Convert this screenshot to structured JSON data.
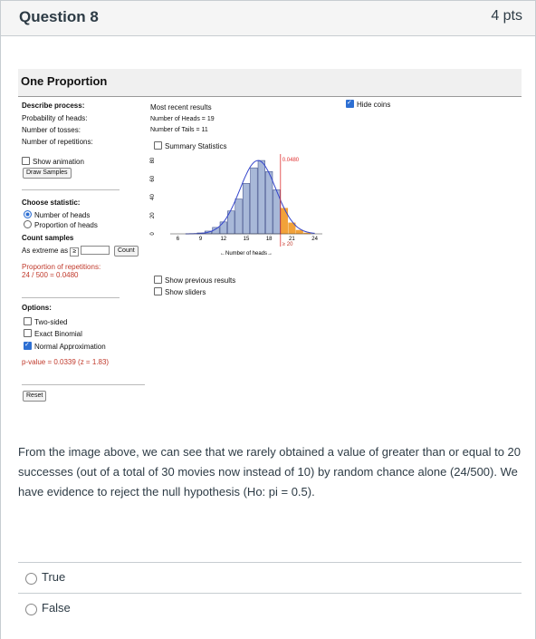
{
  "question": {
    "title": "Question 8",
    "points": "4 pts"
  },
  "applet": {
    "title": "One Proportion",
    "describe": {
      "heading": "Describe process:",
      "prob_label": "Probability of heads:",
      "tosses_label": "Number of tosses:",
      "reps_label": "Number of repetitions:",
      "show_animation": "Show animation",
      "draw_button": "Draw Samples"
    },
    "results": {
      "heading": "Most recent results",
      "heads": "Number of Heads = 19",
      "tails": "Number of Tails = 11",
      "summary": "Summary Statistics",
      "hide_coins": "Hide coins",
      "show_previous": "Show previous results",
      "show_sliders": "Show sliders"
    },
    "statistic": {
      "heading": "Choose statistic:",
      "opt1": "Number of heads",
      "opt2": "Proportion of heads"
    },
    "count": {
      "heading": "Count samples",
      "extreme_label": "As extreme as",
      "operator": "≥",
      "button": "Count",
      "result_label": "Proportion of repetitions:",
      "result_value": "24 / 500 = 0.0480"
    },
    "options": {
      "heading": "Options:",
      "two_sided": "Two-sided",
      "exact": "Exact Binomial",
      "normal": "Normal Approximation",
      "pvalue": "p-value = 0.0339 (z = 1.83)"
    },
    "reset": "Reset"
  },
  "chart_data": {
    "type": "bar",
    "xlabel": "←Number of heads→",
    "ylabel": "",
    "x_ticks": [
      "6",
      "9",
      "12",
      "15",
      "18",
      "21",
      "24"
    ],
    "y_ticks": [
      "0",
      "20",
      "40",
      "60",
      "80"
    ],
    "ylim": [
      0,
      85
    ],
    "xlim": [
      5,
      25
    ],
    "cutoff": 20,
    "cutoff_label": "≥ 20",
    "proportion_label": "0.0480",
    "heads": [
      9,
      10,
      11,
      12,
      13,
      14,
      15,
      16,
      17,
      18,
      19,
      20,
      21,
      22,
      23
    ],
    "counts": [
      1,
      3,
      7,
      13,
      25,
      38,
      55,
      72,
      80,
      68,
      48,
      28,
      12,
      4,
      1
    ],
    "normal_curve": true
  },
  "statement": "From the image above, we can see that we rarely obtained a value of greater than or equal to 20 successes (out of a total of 30 movies now instead of 10) by random chance alone (24/500). We have evidence to reject the null hypothesis (Ho: pi = 0.5).",
  "answers": [
    "True",
    "False"
  ],
  "colors": {
    "bar_fill": "#a8b8d8",
    "bar_stroke": "#2c3e80",
    "curve": "#3344cc",
    "cutoff": "#e03030",
    "tail": "#f2a23a"
  }
}
